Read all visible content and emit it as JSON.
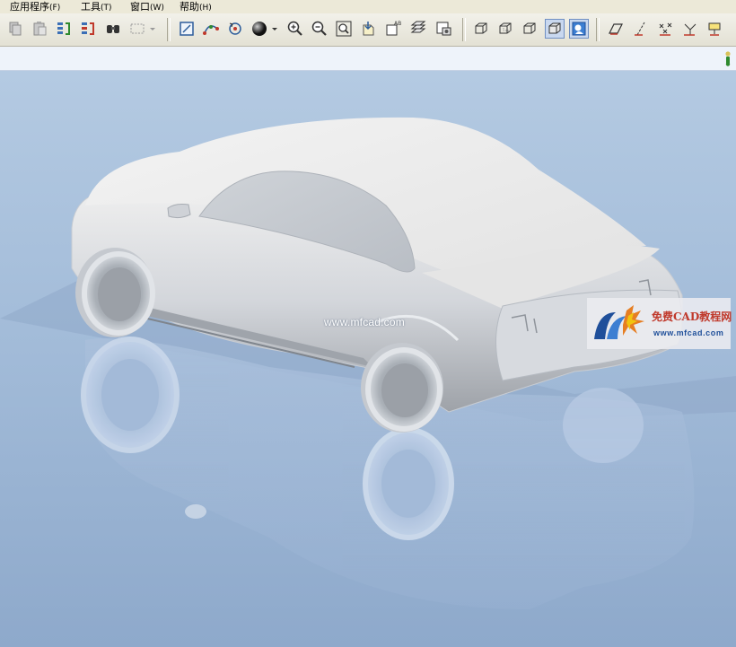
{
  "menu": [
    {
      "label": "应用程序",
      "accel": "(F)"
    },
    {
      "label": "工具",
      "accel": "(T)"
    },
    {
      "label": "窗口",
      "accel": "(W)"
    },
    {
      "label": "帮助",
      "accel": "(H)"
    }
  ],
  "toolbar": {
    "icons": [
      "copy-icon",
      "paste-icon",
      "regenerate-icon",
      "regenerate-manager-icon",
      "find-icon",
      "select-box-icon",
      "sketch-icon",
      "datum-curve-icon",
      "spin-center-icon",
      "shading-icon",
      "zoom-in-icon",
      "zoom-out-icon",
      "refit-icon",
      "reorient-icon",
      "named-views-icon",
      "layers-icon",
      "view-manager-icon",
      "wireframe-icon",
      "hidden-line-icon",
      "no-hidden-icon",
      "shading-display-icon",
      "enhanced-realism-icon",
      "datum-planes-icon",
      "datum-axes-icon",
      "datum-points-icon",
      "coordinate-systems-icon",
      "annotations-icon"
    ]
  },
  "watermark": {
    "center_text": "www.mfcad.com",
    "logo_title": "免费CAD教程网",
    "logo_url": "www.mfcad.com"
  },
  "colors": {
    "background_top": "#b4cae2",
    "background_bottom": "#8ea9cb",
    "model": "#d9dde3",
    "logo_red": "#c0392b",
    "logo_blue": "#1f4f9a"
  }
}
